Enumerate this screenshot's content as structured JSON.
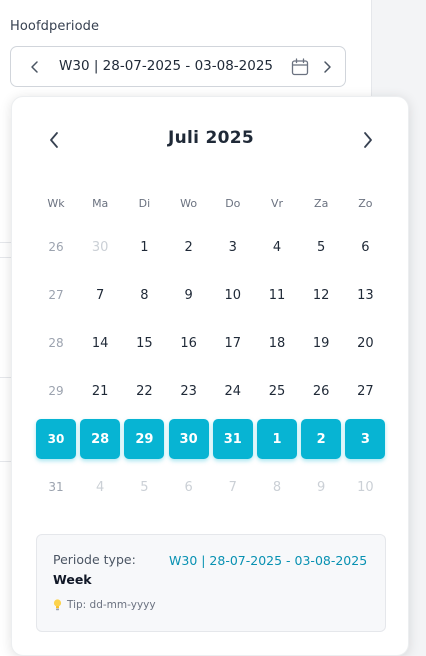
{
  "field": {
    "label": "Hoofdperiode",
    "value": "W30 | 28-07-2025 - 03-08-2025"
  },
  "calendar": {
    "month_title": "Juli 2025",
    "headers": [
      "Wk",
      "Ma",
      "Di",
      "Wo",
      "Do",
      "Vr",
      "Za",
      "Zo"
    ],
    "weeks": [
      {
        "wk": "26",
        "days": [
          "30",
          "1",
          "2",
          "3",
          "4",
          "5",
          "6"
        ],
        "muted": [
          true,
          false,
          false,
          false,
          false,
          false,
          false
        ]
      },
      {
        "wk": "27",
        "days": [
          "7",
          "8",
          "9",
          "10",
          "11",
          "12",
          "13"
        ],
        "muted": [
          false,
          false,
          false,
          false,
          false,
          false,
          false
        ]
      },
      {
        "wk": "28",
        "days": [
          "14",
          "15",
          "16",
          "17",
          "18",
          "19",
          "20"
        ],
        "muted": [
          false,
          false,
          false,
          false,
          false,
          false,
          false
        ]
      },
      {
        "wk": "29",
        "days": [
          "21",
          "22",
          "23",
          "24",
          "25",
          "26",
          "27"
        ],
        "muted": [
          false,
          false,
          false,
          false,
          false,
          false,
          false
        ]
      },
      {
        "wk": "30",
        "days": [
          "28",
          "29",
          "30",
          "31",
          "1",
          "2",
          "3"
        ],
        "muted": [
          false,
          false,
          false,
          false,
          false,
          false,
          false
        ],
        "selected": true
      },
      {
        "wk": "31",
        "days": [
          "4",
          "5",
          "6",
          "7",
          "8",
          "9",
          "10"
        ],
        "muted": [
          true,
          true,
          true,
          true,
          true,
          true,
          true
        ]
      }
    ],
    "selected_color": "#07b4d3"
  },
  "info": {
    "type_label": "Periode type:",
    "type_value": "Week",
    "period_value": "W30 | 28-07-2025 - 03-08-2025",
    "tip": "Tip: dd-mm-yyyy",
    "accent_color": "#0891b2"
  },
  "icons": {
    "prev": "chevron-left-icon",
    "next": "chevron-right-icon",
    "calendar": "calendar-icon",
    "tip": "lightbulb-icon"
  }
}
